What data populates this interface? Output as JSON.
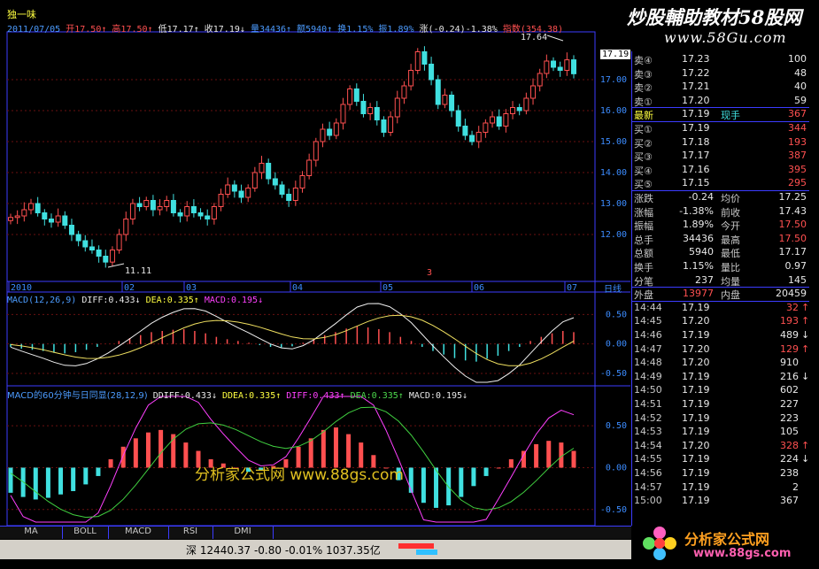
{
  "stock": {
    "name": "独一味",
    "date": "2011/07/05",
    "open_label": "开",
    "open": "17.50",
    "high_label": "高",
    "high": "17.50",
    "low_label": "低",
    "low": "17.17",
    "close_label": "收",
    "close": "17.19",
    "vol_label": "量",
    "vol": "34436",
    "amt_label": "额",
    "amt": "5940",
    "turn_label": "换",
    "turn": "1.15%",
    "amp_label": "振",
    "amp": "1.89%",
    "chg_label": "涨",
    "chg": "(-0.24)-1.38%",
    "index_label": "指数",
    "index": "(354.38)",
    "hi_mark": "17.64",
    "lo_mark": "11.11",
    "cur_price": "17.19",
    "period": "日线",
    "marker": "3"
  },
  "brand_top": {
    "title": "炒股輔助教材58股网",
    "url": "www.58Gu.com"
  },
  "watermark": {
    "text": "分析家公式网 www.88gs.com"
  },
  "macd_panel": {
    "title": "MACD(12,26,9)",
    "diff_label": "DIFF:",
    "diff": "0.433",
    "dea_label": "DEA:",
    "dea": "0.335",
    "macd_label": "MACD:",
    "macd": "0.195"
  },
  "macd60_panel": {
    "title": "MACD的60分钟与日同显(28,12,9)",
    "ddiff_label": "DDIFF:",
    "ddiff": "0.433",
    "ddea_label": "DDEA:",
    "ddea": "0.335",
    "diff_label": "DIFF:",
    "diff": "0.433",
    "dea_label": "DEA:",
    "dea": "0.335",
    "macd_label": "MACD:",
    "macd": "0.195"
  },
  "chart_data": {
    "type": "candlestick",
    "title": "独一味",
    "x_tick_labels": [
      "2010",
      "02",
      "03",
      "04",
      "05",
      "06",
      "07"
    ],
    "y_axis": {
      "ticks": [
        12.0,
        13.0,
        14.0,
        15.0,
        16.0,
        17.0
      ],
      "ylim": [
        11.0,
        18.2
      ]
    },
    "price_path": [
      12.55,
      12.6,
      12.8,
      13.0,
      12.7,
      12.5,
      12.4,
      12.6,
      12.3,
      12.0,
      11.8,
      11.6,
      11.5,
      11.3,
      11.11,
      11.5,
      12.0,
      12.5,
      13.0,
      12.9,
      13.1,
      12.8,
      12.9,
      13.1,
      12.7,
      12.6,
      12.9,
      12.7,
      12.6,
      12.5,
      12.9,
      13.3,
      13.6,
      13.4,
      13.2,
      13.5,
      14.0,
      14.3,
      13.8,
      13.6,
      13.3,
      13.1,
      13.5,
      13.9,
      14.4,
      15.0,
      15.4,
      15.2,
      15.6,
      16.2,
      16.7,
      16.3,
      15.9,
      16.1,
      15.7,
      15.3,
      15.8,
      16.4,
      16.8,
      17.3,
      17.9,
      17.5,
      17.0,
      16.2,
      16.5,
      16.0,
      15.5,
      15.2,
      15.0,
      15.3,
      15.6,
      15.8,
      15.5,
      15.9,
      16.1,
      16.0,
      16.4,
      16.8,
      17.2,
      17.6,
      17.4,
      17.3,
      17.64,
      17.19
    ],
    "macd_axis": {
      "ticks": [
        0.5,
        0.0,
        -0.5
      ],
      "ylim": [
        -0.65,
        0.7
      ]
    },
    "macd_hist": [
      -0.05,
      -0.08,
      -0.1,
      -0.12,
      -0.15,
      -0.16,
      -0.14,
      -0.1,
      -0.05,
      0.0,
      0.05,
      0.1,
      0.15,
      0.2,
      0.22,
      0.24,
      0.25,
      0.22,
      0.18,
      0.12,
      0.08,
      0.05,
      0.02,
      -0.02,
      -0.05,
      -0.06,
      -0.04,
      0.02,
      0.08,
      0.15,
      0.2,
      0.26,
      0.3,
      0.28,
      0.25,
      0.2,
      0.12,
      0.05,
      -0.05,
      -0.12,
      -0.18,
      -0.24,
      -0.28,
      -0.3,
      -0.25,
      -0.2,
      -0.12,
      -0.05,
      0.05,
      0.12,
      0.18,
      0.22,
      0.2
    ],
    "macd60_axis": {
      "ticks": [
        0.5,
        0.0,
        -0.5
      ],
      "ylim": [
        -0.65,
        0.85
      ]
    },
    "macd60_hist": [
      -0.3,
      -0.35,
      -0.38,
      -0.36,
      -0.32,
      -0.28,
      -0.2,
      -0.1,
      0.1,
      0.25,
      0.35,
      0.42,
      0.45,
      0.4,
      0.3,
      0.2,
      0.1,
      0.05,
      0.0,
      -0.05,
      -0.03,
      0.02,
      0.1,
      0.25,
      0.35,
      0.45,
      0.48,
      0.4,
      0.3,
      0.15,
      0.0,
      -0.15,
      -0.3,
      -0.42,
      -0.48,
      -0.45,
      -0.35,
      -0.22,
      -0.1,
      0.0,
      0.1,
      0.2,
      0.28,
      0.32,
      0.3,
      0.2
    ]
  },
  "quote": {
    "sell": [
      {
        "label": "卖④",
        "price": "17.23",
        "vol": "100"
      },
      {
        "label": "卖③",
        "price": "17.22",
        "vol": "48"
      },
      {
        "label": "卖②",
        "price": "17.21",
        "vol": "40"
      },
      {
        "label": "卖①",
        "price": "17.20",
        "vol": "59"
      }
    ],
    "latest": {
      "label": "最新",
      "price": "17.19",
      "now_label": "现手",
      "now": "367"
    },
    "buy": [
      {
        "label": "买①",
        "price": "17.19",
        "vol": "344"
      },
      {
        "label": "买②",
        "price": "17.18",
        "vol": "193"
      },
      {
        "label": "买③",
        "price": "17.17",
        "vol": "387"
      },
      {
        "label": "买④",
        "price": "17.16",
        "vol": "395"
      },
      {
        "label": "买⑤",
        "price": "17.15",
        "vol": "295"
      }
    ],
    "stats": [
      {
        "l1": "涨跌",
        "v1": "-0.24",
        "l2": "均价",
        "v2": "17.25"
      },
      {
        "l1": "涨幅",
        "v1": "-1.38%",
        "l2": "前收",
        "v2": "17.43"
      },
      {
        "l1": "振幅",
        "v1": "1.89%",
        "l2": "今开",
        "v2": "17.50"
      },
      {
        "l1": "总手",
        "v1": "34436",
        "l2": "最高",
        "v2": "17.50"
      },
      {
        "l1": "总额",
        "v1": "5940",
        "l2": "最低",
        "v2": "17.17"
      },
      {
        "l1": "换手",
        "v1": "1.15%",
        "l2": "量比",
        "v2": "0.97"
      },
      {
        "l1": "分笔",
        "v1": "237",
        "l2": "均量",
        "v2": "145"
      }
    ],
    "outer_label": "外盘",
    "outer": "13977",
    "inner_label": "内盘",
    "inner": "20459",
    "ticks": [
      {
        "time": "14:44",
        "price": "17.19",
        "vol": "32",
        "dir": "up"
      },
      {
        "time": "14:45",
        "price": "17.20",
        "vol": "193",
        "dir": "up"
      },
      {
        "time": "14:46",
        "price": "17.19",
        "vol": "489",
        "dir": "down"
      },
      {
        "time": "14:47",
        "price": "17.20",
        "vol": "129",
        "dir": "up"
      },
      {
        "time": "14:48",
        "price": "17.20",
        "vol": "910",
        "dir": "none"
      },
      {
        "time": "14:49",
        "price": "17.19",
        "vol": "216",
        "dir": "down"
      },
      {
        "time": "14:50",
        "price": "17.19",
        "vol": "602",
        "dir": "none"
      },
      {
        "time": "14:51",
        "price": "17.19",
        "vol": "227",
        "dir": "none"
      },
      {
        "time": "14:52",
        "price": "17.19",
        "vol": "223",
        "dir": "none"
      },
      {
        "time": "14:53",
        "price": "17.19",
        "vol": "105",
        "dir": "none"
      },
      {
        "time": "14:54",
        "price": "17.20",
        "vol": "328",
        "dir": "up"
      },
      {
        "time": "14:55",
        "price": "17.19",
        "vol": "224",
        "dir": "down"
      },
      {
        "time": "14:56",
        "price": "17.19",
        "vol": "238",
        "dir": "none"
      },
      {
        "time": "14:57",
        "price": "17.19",
        "vol": "2",
        "dir": "none"
      },
      {
        "time": "15:00",
        "price": "17.19",
        "vol": "367",
        "dir": "none"
      }
    ]
  },
  "tabs": [
    "MA",
    "BOLL",
    "MACD",
    "RSI",
    "DMI"
  ],
  "status": {
    "exchange": "深",
    "index": "12440.37",
    "change": "-0.80",
    "pct": "-0.01%",
    "amount": "1037.35亿"
  },
  "brand_bottom": {
    "name": "分析家公式网",
    "url": "www.88gs.com"
  },
  "colors": {
    "up": "#ff5050",
    "down": "#40e0e0",
    "axis": "#3c3cff",
    "grid": "#6a1010"
  }
}
